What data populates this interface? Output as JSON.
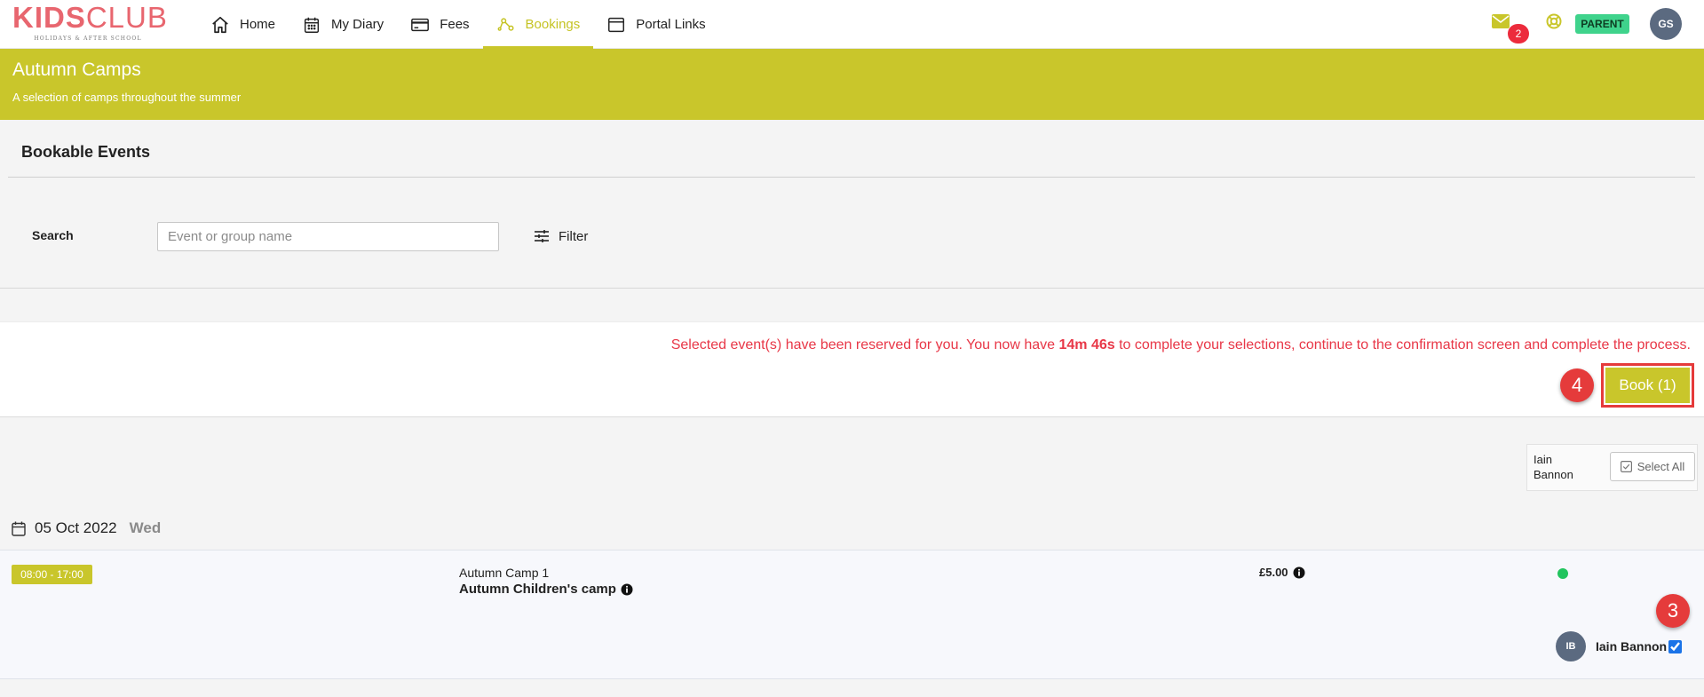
{
  "logo": {
    "main_part1": "KIDS",
    "main_part2": "CLUB",
    "tagline": "HOLIDAYS & AFTER SCHOOL"
  },
  "nav": {
    "items": [
      {
        "label": "Home",
        "icon": "home-icon"
      },
      {
        "label": "My Diary",
        "icon": "calendar-icon"
      },
      {
        "label": "Fees",
        "icon": "credit-card-icon"
      },
      {
        "label": "Bookings",
        "icon": "bookings-icon",
        "active": true
      },
      {
        "label": "Portal Links",
        "icon": "window-icon"
      }
    ]
  },
  "header_right": {
    "mail_count": "2",
    "role": "PARENT",
    "user_initials": "GS"
  },
  "banner": {
    "title": "Autumn Camps",
    "subtitle": "A selection of camps throughout the summer"
  },
  "bookable": {
    "title": "Bookable Events",
    "search_label": "Search",
    "search_placeholder": "Event or group name",
    "search_value": "",
    "filter_label": "Filter"
  },
  "reservation": {
    "message_before": "Selected event(s) have been reserved for you. You now have ",
    "time_left": "14m 46s",
    "message_after": " to complete your selections, continue to the confirmation screen and complete the process.",
    "book_label": "Book (1)"
  },
  "steps": {
    "book_step": "4",
    "check_step": "3"
  },
  "select_card": {
    "child_name": "Iain Bannon",
    "select_all_label": "Select All"
  },
  "date_group": {
    "date": "05 Oct 2022",
    "weekday": "Wed"
  },
  "event": {
    "time": "08:00  - 17:00",
    "group": "Autumn Camp 1",
    "name": "Autumn Children's camp",
    "price": "£5.00",
    "status_color": "#22c45e",
    "child_initials": "IB",
    "child_name": "Iain Bannon",
    "child_checked": true
  },
  "colors": {
    "accent": "#c9c62b",
    "alert": "#e83747",
    "badge_red": "#e53b3b",
    "role_green": "#3fd38c",
    "brand_pink": "#e8666f"
  }
}
